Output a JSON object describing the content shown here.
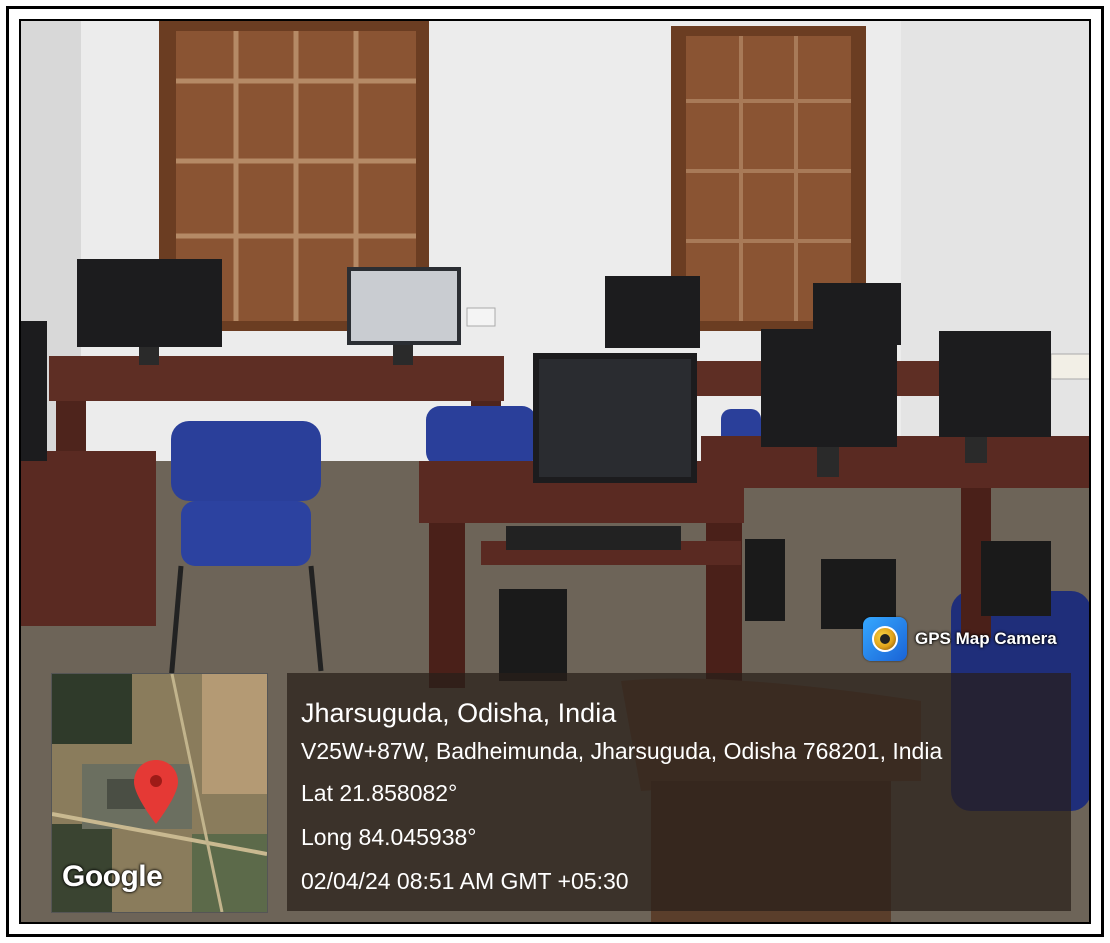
{
  "watermark": {
    "app_label": "GPS Map Camera",
    "app_icon": "gps-map-camera-icon"
  },
  "map": {
    "provider_label": "Google",
    "pin_icon": "map-pin-icon"
  },
  "location": {
    "title": "Jharsuguda, Odisha, India",
    "address": "V25W+87W, Badheimunda, Jharsuguda, Odisha 768201, India",
    "latitude": "Lat 21.858082°",
    "longitude": "Long 84.045938°",
    "timestamp": "02/04/24 08:51 AM GMT +05:30"
  },
  "colors": {
    "pin": "#e53935",
    "overlay": "#2a1f1a",
    "chair_blue": "#2a3f9a",
    "desk_brown": "#5a2a22"
  }
}
